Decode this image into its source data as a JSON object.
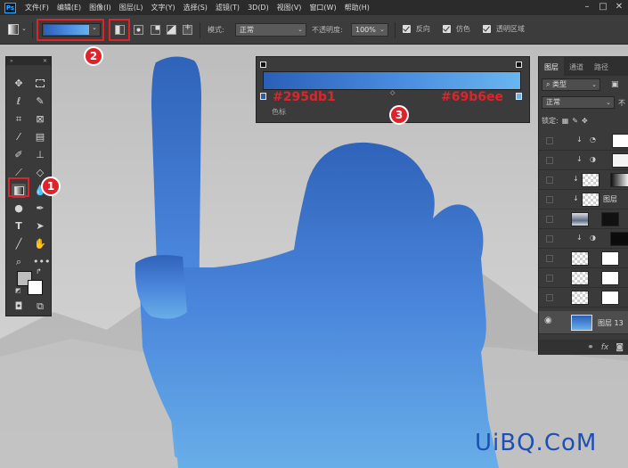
{
  "app": {
    "logo_text": "Ps",
    "menu": [
      "文件(F)",
      "编辑(E)",
      "图像(I)",
      "图层(L)",
      "文字(Y)",
      "选择(S)",
      "滤镜(T)",
      "3D(D)",
      "视图(V)",
      "窗口(W)",
      "帮助(H)"
    ]
  },
  "options_bar": {
    "mode_label": "模式:",
    "mode_value": "正常",
    "opacity_label": "不透明度:",
    "opacity_value": "100%",
    "reverse_label": "反向",
    "reverse_checked": true,
    "dither_label": "仿色",
    "dither_checked": true,
    "transparency_label": "透明区域",
    "transparency_checked": true
  },
  "annotations": [
    "1",
    "2",
    "3"
  ],
  "gradient_editor": {
    "left_color": "#295db1",
    "right_color": "#69b6ee",
    "stops_label": "色标"
  },
  "layers_panel": {
    "tabs": [
      "图层",
      "通道",
      "路径"
    ],
    "filter_label": "类型",
    "blend_mode": "正常",
    "opacity_label_partial": "不",
    "lock_label": "锁定:",
    "layer_labels": [
      "图层",
      "图层 13"
    ],
    "bottom_icons": [
      "link-icon",
      "fx-icon",
      "mask-icon"
    ]
  },
  "watermark": "UiBQ.CoM"
}
